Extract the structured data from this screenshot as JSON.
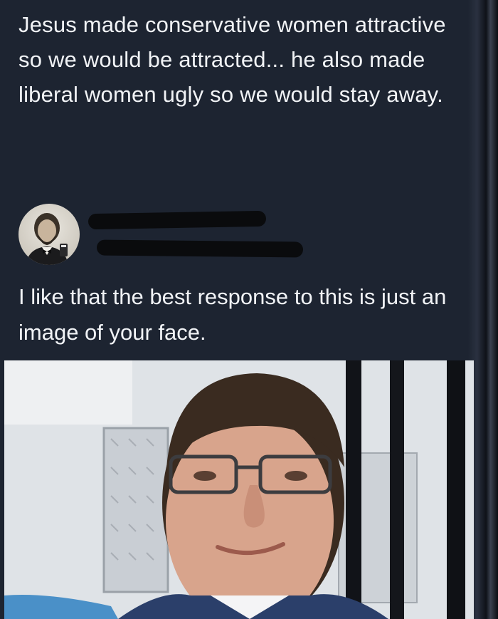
{
  "post": {
    "text": "Jesus made conservative women attractive so we would be attracted... he also made liberal women ugly so we would stay away."
  },
  "author": {
    "avatar_icon": "lincoln-portrait-avatar-icon",
    "name_redacted": true,
    "handle_redacted": true
  },
  "reply": {
    "text": "I like that the best response to this is just an image of your face."
  },
  "photo": {
    "subject": "selfie-photo"
  },
  "colors": {
    "background": "#1d2431",
    "text": "#f1f3f6",
    "redaction": "#0a0b0d"
  }
}
